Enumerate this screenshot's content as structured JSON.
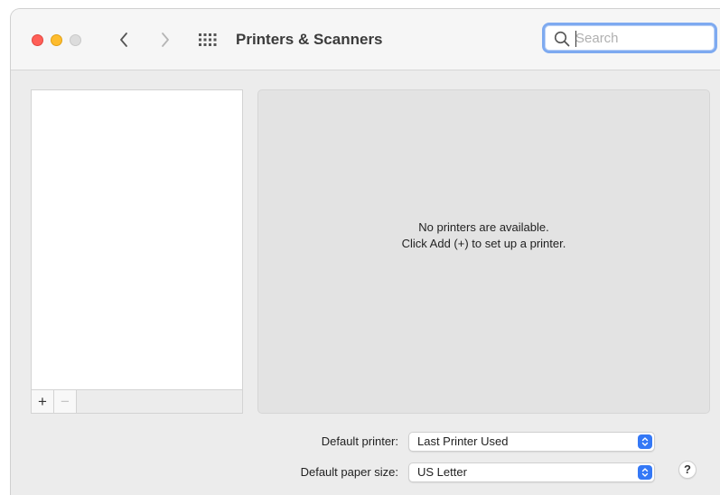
{
  "window": {
    "title": "Printers & Scanners",
    "accent_color": "#3478f6"
  },
  "toolbar": {
    "back_icon": "chevron-left-icon",
    "forward_icon": "chevron-right-icon",
    "grid_icon": "grid-icon"
  },
  "search": {
    "placeholder": "Search",
    "value": ""
  },
  "printer_list": {
    "add_label": "+",
    "remove_label": "−"
  },
  "details": {
    "empty_line1": "No printers are available.",
    "empty_line2": "Click Add (+) to set up a printer."
  },
  "settings": {
    "default_printer_label": "Default printer:",
    "default_printer_value": "Last Printer Used",
    "paper_size_label": "Default paper size:",
    "paper_size_value": "US Letter"
  },
  "help": {
    "label": "?"
  }
}
